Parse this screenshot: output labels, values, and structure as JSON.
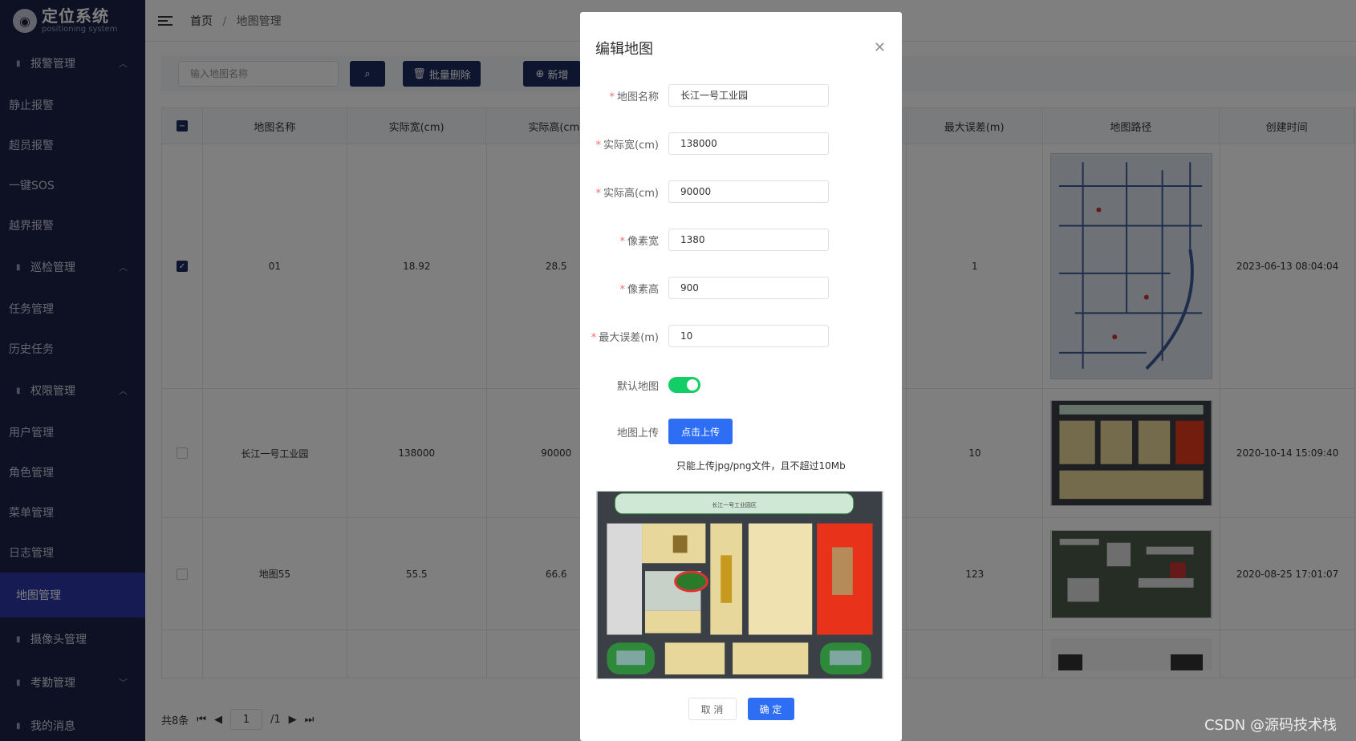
{
  "logo": {
    "title": "定位系统",
    "subtitle": "positioning system"
  },
  "sidebar": {
    "groups": [
      {
        "label": "报警管理",
        "items": [
          "静止报警",
          "超员报警",
          "一键SOS",
          "越界报警"
        ]
      },
      {
        "label": "巡检管理",
        "items": [
          "任务管理",
          "历史任务"
        ]
      },
      {
        "label": "权限管理",
        "items": [
          "用户管理",
          "角色管理",
          "菜单管理",
          "日志管理"
        ]
      }
    ],
    "active_item": "地图管理",
    "extra": [
      "摄像头管理",
      "考勤管理",
      "我的消息"
    ]
  },
  "breadcrumb": {
    "home": "首页",
    "separator": "/",
    "current": "地图管理"
  },
  "toolbar": {
    "search_placeholder": "输入地图名称",
    "batch_delete_label": "批量删除",
    "add_label": "新增"
  },
  "table": {
    "columns": [
      "地图名称",
      "实际宽(cm)",
      "实际高(cm)",
      "",
      "最大误差(m)",
      "地图路径",
      "创建时间"
    ],
    "rows": [
      {
        "checked": true,
        "name": "01",
        "width": "18.92",
        "height": "28.5",
        "error": "1",
        "created": "2023-06-13 08:04:04"
      },
      {
        "checked": false,
        "name": "长江一号工业园",
        "width": "138000",
        "height": "90000",
        "error": "10",
        "created": "2020-10-14 15:09:40"
      },
      {
        "checked": false,
        "name": "地图55",
        "width": "55.5",
        "height": "66.6",
        "error": "123",
        "created": "2020-08-25 17:01:07"
      }
    ]
  },
  "pager": {
    "total": "共8条",
    "page": "1",
    "pages": "/1"
  },
  "dialog": {
    "title": "编辑地图",
    "fields": [
      {
        "label": "地图名称",
        "value": "长江一号工业园",
        "required": true
      },
      {
        "label": "实际宽(cm)",
        "value": "138000",
        "required": true
      },
      {
        "label": "实际高(cm)",
        "value": "90000",
        "required": true
      },
      {
        "label": "像素宽",
        "value": "1380",
        "required": true
      },
      {
        "label": "像素高",
        "value": "900",
        "required": true
      },
      {
        "label": "最大误差(m)",
        "value": "10",
        "required": true
      }
    ],
    "default_map_label": "默认地图",
    "default_map_on": true,
    "upload_label": "地图上传",
    "upload_button": "点击上传",
    "upload_tip": "只能上传jpg/png文件，且不超过10Mb",
    "preview_title": "长江一号工业园区",
    "cancel_label": "取 消",
    "ok_label": "确 定"
  },
  "watermark": "CSDN @源码技术栈",
  "colors": {
    "sidebar_bg": "#1c2246",
    "active_bg": "#2d37a8",
    "primary": "#2e6ef5",
    "dark_button": "#1d2b5e",
    "switch_on": "#13ce66"
  }
}
